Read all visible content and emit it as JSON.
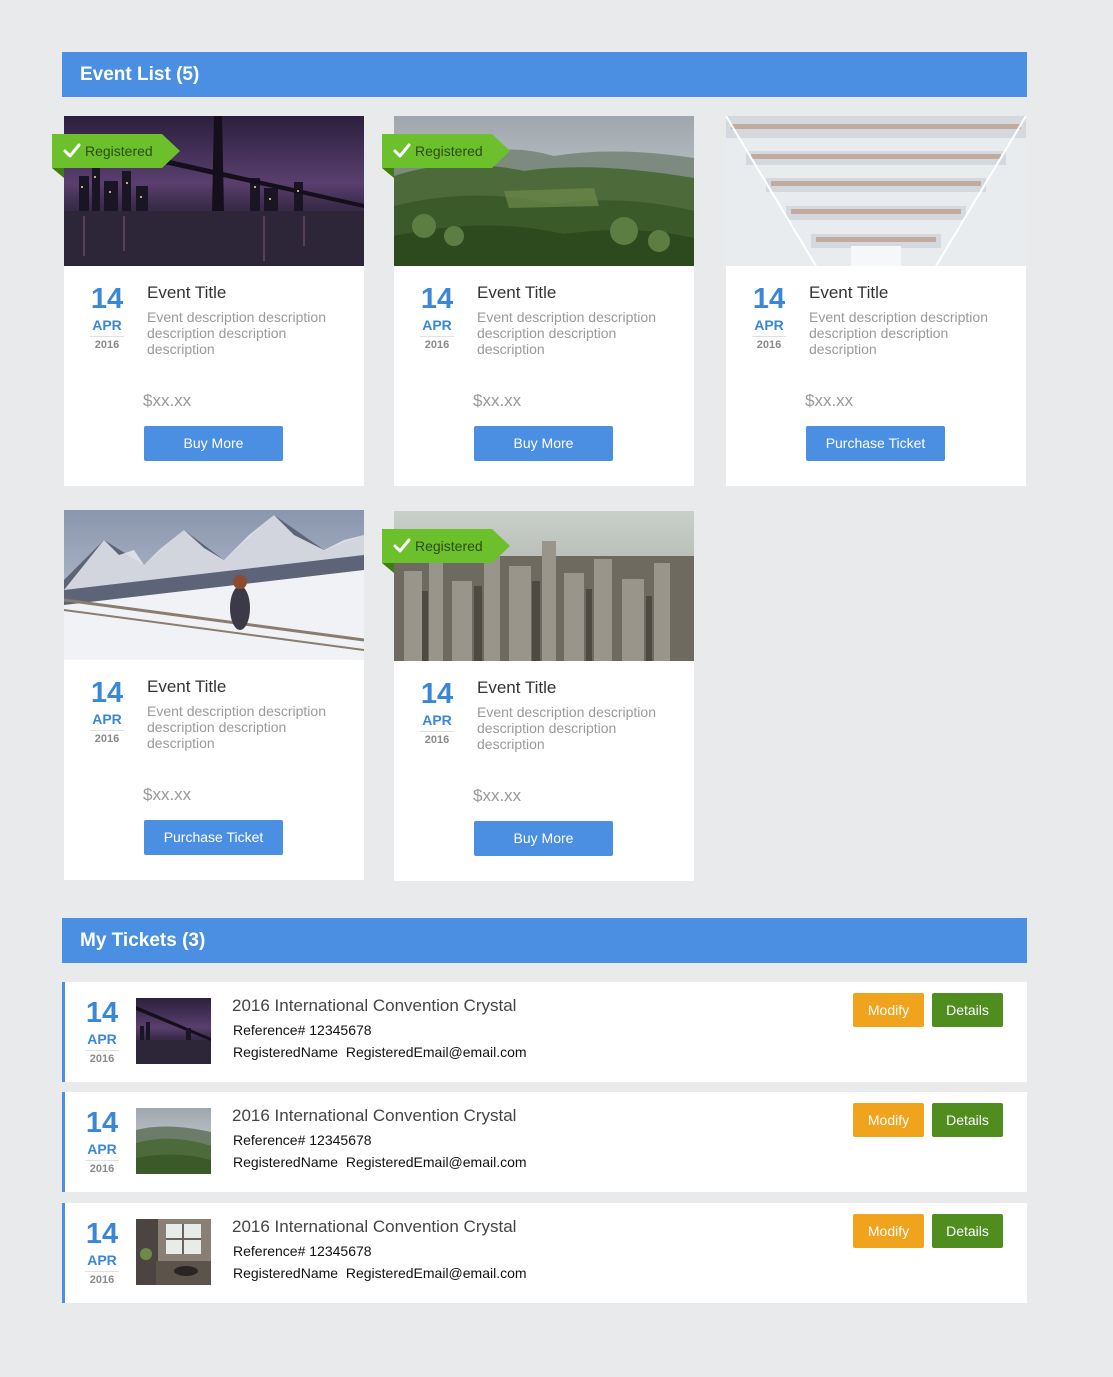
{
  "event_list": {
    "header": "Event List (5)",
    "events": [
      {
        "registered": true,
        "registered_label": "Registered",
        "day": "14",
        "month": "APR",
        "year": "2016",
        "title": "Event Title",
        "description": "Event description description description description description",
        "price": "$xx.xx",
        "button_label": "Buy More",
        "image": "bridge-night-skyline-photo"
      },
      {
        "registered": true,
        "registered_label": "Registered",
        "day": "14",
        "month": "APR",
        "year": "2016",
        "title": "Event Title",
        "description": "Event description description description description description",
        "price": "$xx.xx",
        "button_label": "Buy More",
        "image": "green-hills-landscape-photo"
      },
      {
        "registered": false,
        "registered_label": "",
        "day": "14",
        "month": "APR",
        "year": "2016",
        "title": "Event Title",
        "description": "Event description description description description description",
        "price": "$xx.xx",
        "button_label": "Purchase Ticket",
        "image": "library-interior-photo"
      },
      {
        "registered": false,
        "registered_label": "",
        "day": "14",
        "month": "APR",
        "year": "2016",
        "title": "Event Title",
        "description": "Event description description description description description",
        "price": "$xx.xx",
        "button_label": "Purchase Ticket",
        "image": "snowy-mountains-photo"
      },
      {
        "registered": true,
        "registered_label": "Registered",
        "day": "14",
        "month": "APR",
        "year": "2016",
        "title": "Event Title",
        "description": "Event description description description description description",
        "price": "$xx.xx",
        "button_label": "Buy More",
        "image": "city-skyscrapers-photo"
      }
    ]
  },
  "my_tickets": {
    "header": "My Tickets (3)",
    "tickets": [
      {
        "day": "14",
        "month": "APR",
        "year": "2016",
        "title": "2016 International Convention Crystal",
        "reference": "Reference# 12345678",
        "registered_name": "RegisteredName",
        "registered_email": "RegisteredEmail@email.com",
        "modify_label": "Modify",
        "details_label": "Details",
        "image": "bridge-night-skyline-photo"
      },
      {
        "day": "14",
        "month": "APR",
        "year": "2016",
        "title": "2016 International Convention Crystal",
        "reference": "Reference# 12345678",
        "registered_name": "RegisteredName",
        "registered_email": "RegisteredEmail@email.com",
        "modify_label": "Modify",
        "details_label": "Details",
        "image": "green-hills-landscape-photo"
      },
      {
        "day": "14",
        "month": "APR",
        "year": "2016",
        "title": "2016 International Convention Crystal",
        "reference": "Reference# 12345678",
        "registered_name": "RegisteredName",
        "registered_email": "RegisteredEmail@email.com",
        "modify_label": "Modify",
        "details_label": "Details",
        "image": "office-interior-photo"
      }
    ]
  },
  "colors": {
    "header_blue": "#4a8fe2",
    "date_blue": "#3a87d8",
    "registered_green": "#6cc02c",
    "modify_orange": "#f0a31d",
    "details_green": "#4f8e1e",
    "page_background": "#e9eaec"
  }
}
